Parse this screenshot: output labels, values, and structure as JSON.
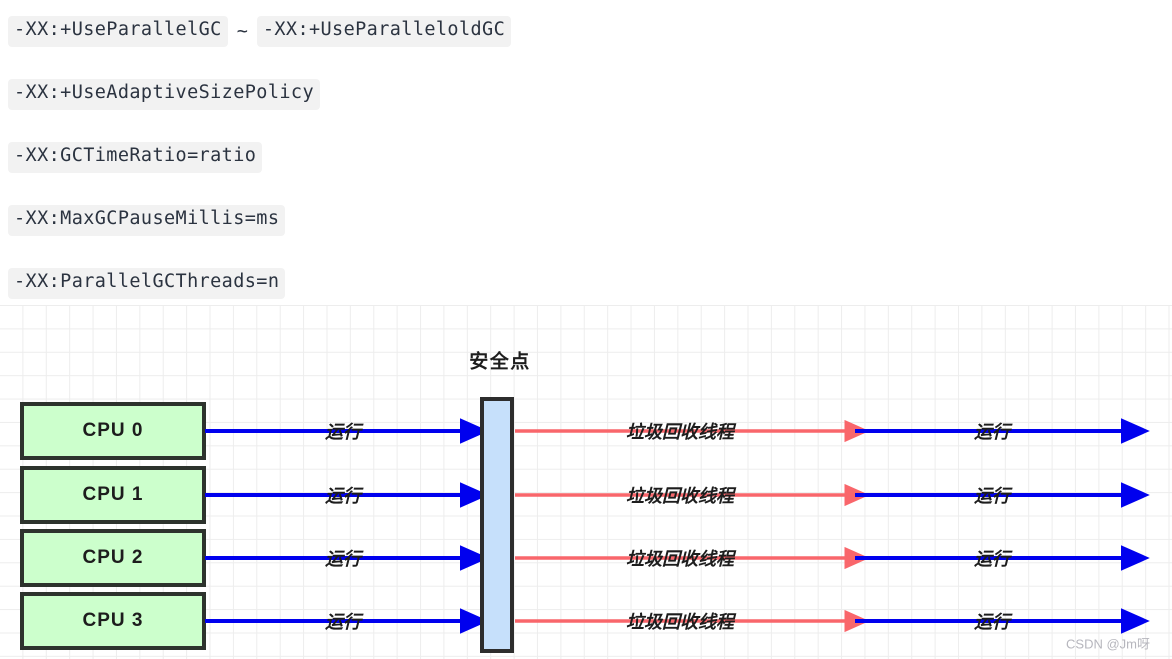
{
  "options": {
    "lines": [
      {
        "type": "pair",
        "left": "-XX:+UseParallelGC",
        "separator": "~",
        "right": "-XX:+UseParalleloldGC"
      },
      {
        "type": "single",
        "left": "-XX:+UseAdaptiveSizePolicy"
      },
      {
        "type": "single",
        "left": "-XX:GCTimeRatio=ratio"
      },
      {
        "type": "single",
        "left": "-XX:MaxGCPauseMillis=ms"
      },
      {
        "type": "single",
        "left": "-XX:ParallelGCThreads=n"
      }
    ]
  },
  "diagram": {
    "safepoint_title": "安全点",
    "watermark": "CSDN @Jm呀",
    "cpus": [
      {
        "label": "CPU 0",
        "run_before": "运行",
        "gc": "垃圾回收线程",
        "run_after": "运行"
      },
      {
        "label": "CPU 1",
        "run_before": "运行",
        "gc": "垃圾回收线程",
        "run_after": "运行"
      },
      {
        "label": "CPU 2",
        "run_before": "运行",
        "gc": "垃圾回收线程",
        "run_after": "运行"
      },
      {
        "label": "CPU 3",
        "run_before": "运行",
        "gc": "垃圾回收线程",
        "run_after": "运行"
      }
    ],
    "colors": {
      "cpu_box_fill": "#ccffcc",
      "cpu_box_stroke": "#2d332d",
      "safepoint_fill": "#c6e0fb",
      "safepoint_stroke": "#2d2d2d",
      "run_arrow": "#0000ee",
      "gc_arrow": "#f9666b",
      "grid_line": "#ededed",
      "code_badge_bg": "#f2f2f2",
      "code_text": "#2b3340"
    }
  }
}
